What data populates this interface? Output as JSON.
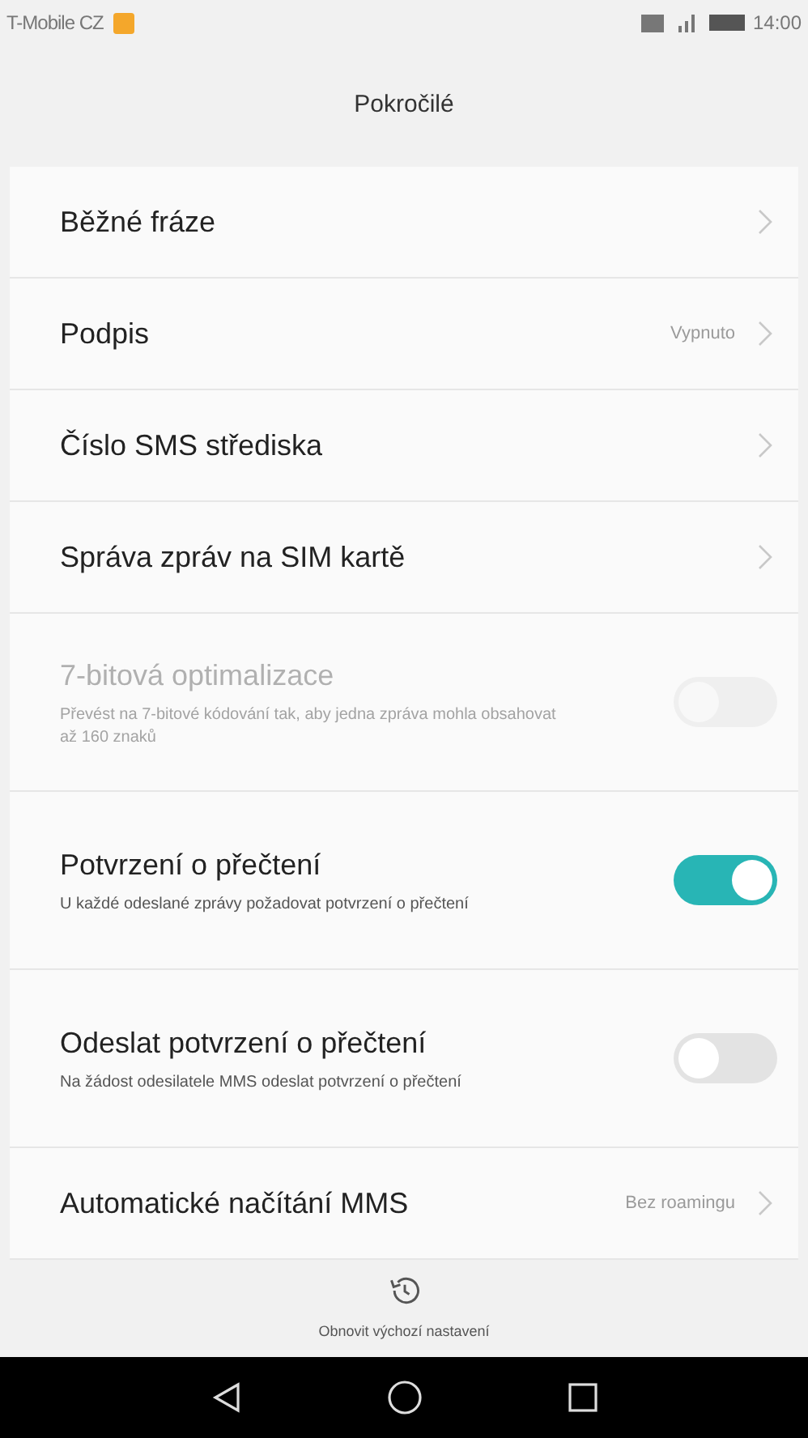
{
  "status_bar": {
    "carrier": "T-Mobile CZ",
    "time": "14:00"
  },
  "title": "Pokročilé",
  "items": [
    {
      "kind": "link",
      "label": "Běžné fráze"
    },
    {
      "kind": "link",
      "label": "Podpis",
      "value": "Vypnuto"
    },
    {
      "kind": "link",
      "label": "Číslo SMS střediska"
    },
    {
      "kind": "link",
      "label": "Správa zpráv na SIM kartě"
    },
    {
      "kind": "switch",
      "label": "7-bitová optimalizace",
      "description": "Převést na 7-bitové kódování tak, aby jedna zpráva mohla obsahovat až 160 znaků",
      "on": false,
      "disabled": true
    },
    {
      "kind": "switch",
      "label": "Potvrzení o přečtení",
      "description": "U každé odeslané zprávy požadovat potvrzení o přečtení",
      "on": true,
      "disabled": false
    },
    {
      "kind": "switch",
      "label": "Odeslat potvrzení o přečtení",
      "description": "Na žádost odesilatele MMS odeslat potvrzení o přečtení",
      "on": false,
      "disabled": false
    },
    {
      "kind": "link",
      "label": "Automatické načítání MMS",
      "value": "Bez roamingu"
    }
  ],
  "footer_action": {
    "label": "Obnovit výchozí nastavení"
  }
}
